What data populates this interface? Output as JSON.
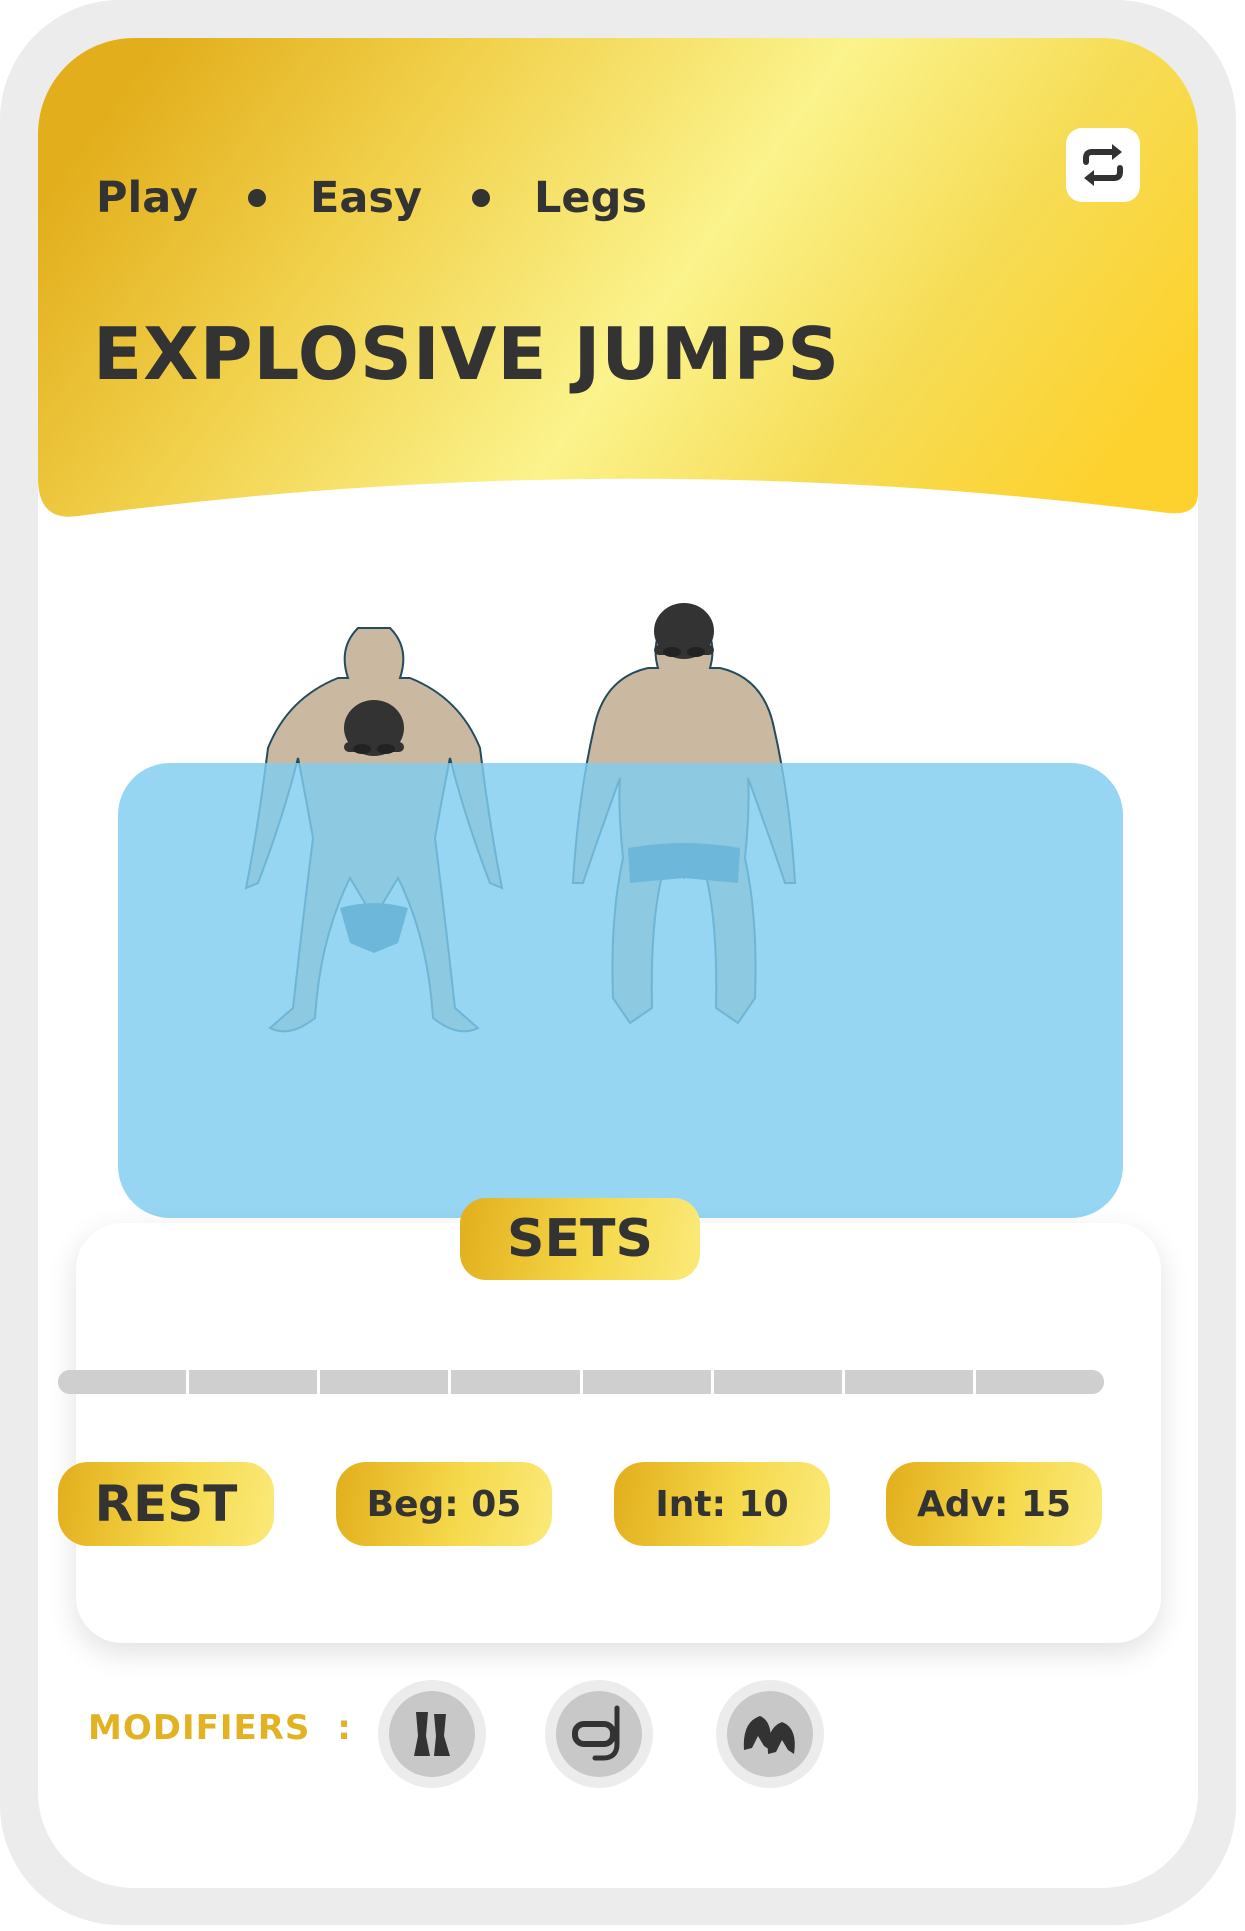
{
  "header": {
    "tags": [
      "Play",
      "Easy",
      "Legs"
    ],
    "title": "EXPLOSIVE JUMPS",
    "switch_icon": "swap-arrows-icon"
  },
  "illustration": {
    "water_color": "#97d6f2",
    "skin_color": "#cbb8a0",
    "trunks_color": "#1f5c78",
    "cap_color": "#333333"
  },
  "sets": {
    "label": "SETS",
    "segments": 8,
    "rest_label": "REST",
    "levels": [
      {
        "label": "Beg: 05"
      },
      {
        "label": "Int: 10"
      },
      {
        "label": "Adv: 15"
      }
    ]
  },
  "modifiers": {
    "label": "MODIFIERS",
    "separator": ":",
    "items": [
      {
        "icon": "fins-icon"
      },
      {
        "icon": "snorkel-mask-icon"
      },
      {
        "icon": "hand-paddles-icon"
      }
    ]
  },
  "colors": {
    "gold_dark": "#e2ae1c",
    "gold_light": "#fbf08c",
    "text_dark": "#333333",
    "modifier_label": "#e2b223"
  }
}
